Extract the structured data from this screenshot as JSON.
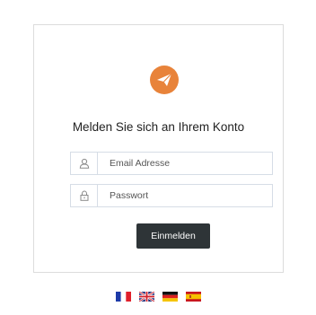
{
  "login": {
    "heading": "Melden Sie sich an Ihrem Konto",
    "email_placeholder": "Email Adresse",
    "password_placeholder": "Passwort",
    "submit_label": "Einmelden"
  },
  "icons": {
    "logo": "paper-plane-icon",
    "email": "user-icon",
    "password": "lock-icon"
  },
  "languages": [
    {
      "code": "fr",
      "flag": "france-flag-icon"
    },
    {
      "code": "en",
      "flag": "uk-flag-icon"
    },
    {
      "code": "de",
      "flag": "germany-flag-icon"
    },
    {
      "code": "es",
      "flag": "spain-flag-icon"
    }
  ],
  "colors": {
    "brand_accent": "#e8833a",
    "button_bg": "#2e3437",
    "field_border": "#d6dde6"
  }
}
